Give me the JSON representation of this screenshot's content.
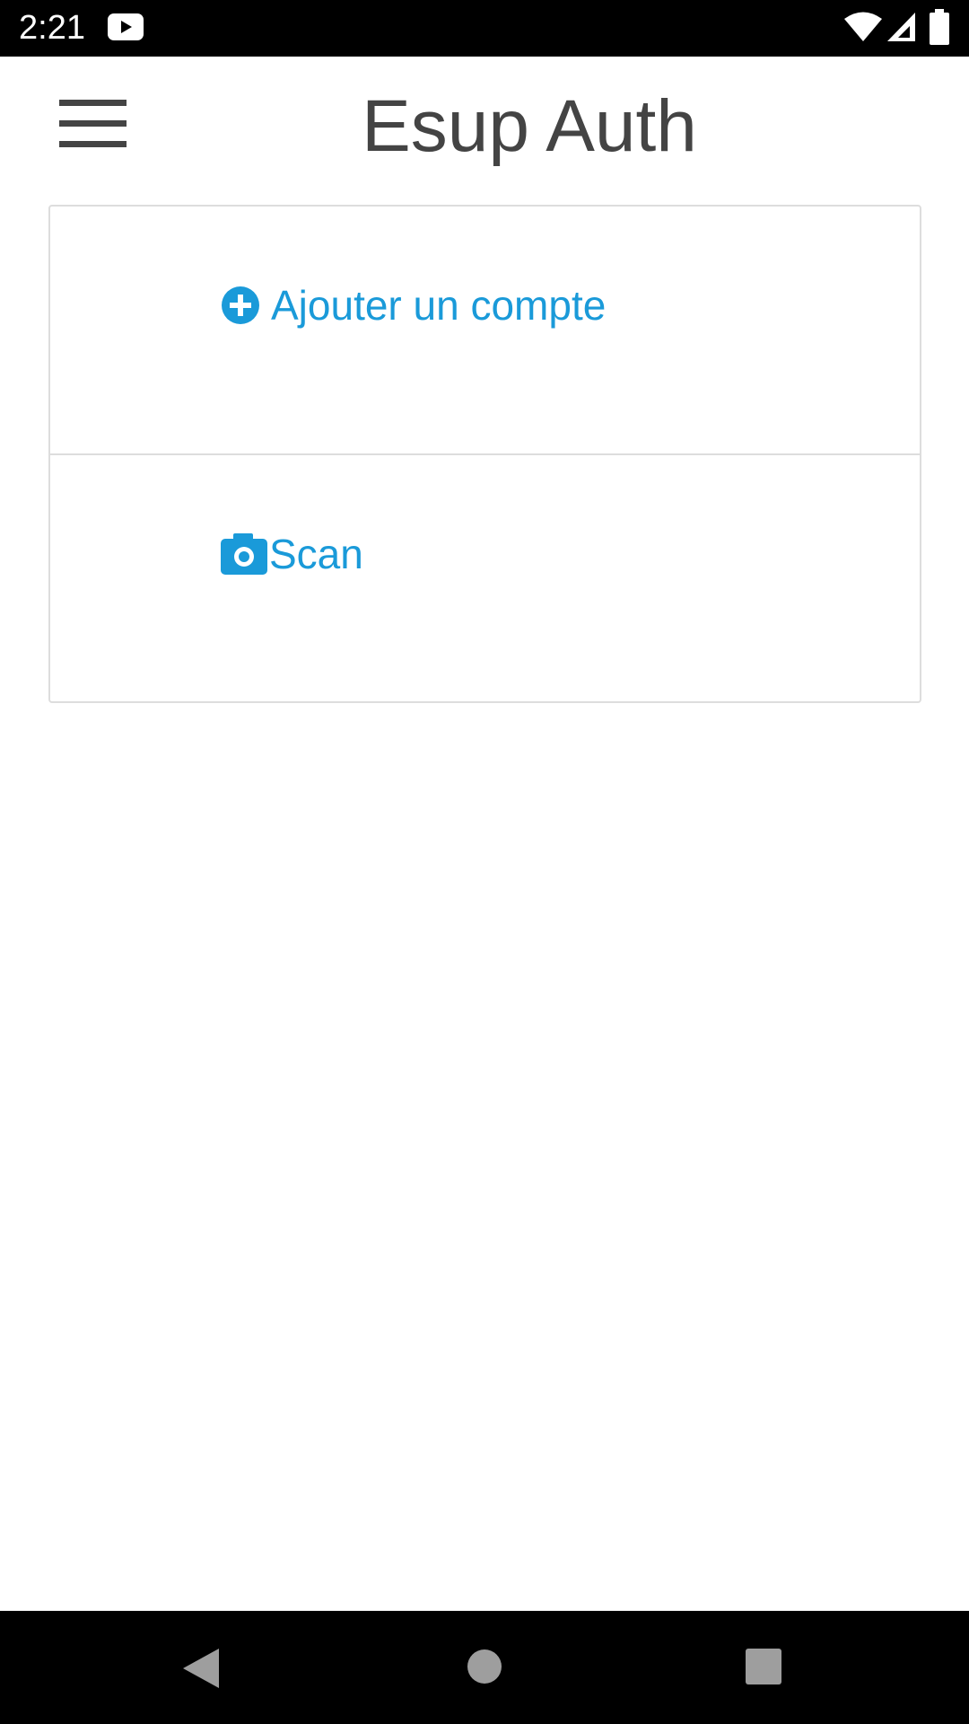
{
  "status_bar": {
    "time": "2:21",
    "icons": [
      "youtube-icon",
      "wifi-icon",
      "signal-icon",
      "battery-icon"
    ]
  },
  "header": {
    "title": "Esup Auth",
    "menu_icon": "hamburger-menu-icon"
  },
  "card": {
    "items": [
      {
        "label": "Ajouter un compte",
        "icon": "plus-circle-icon"
      },
      {
        "label": "Scan",
        "icon": "camera-icon"
      }
    ]
  },
  "nav_bar": {
    "icons": [
      "back-icon",
      "home-icon",
      "recents-icon"
    ]
  },
  "colors": {
    "accent": "#1a9ad9",
    "title_text": "#444444",
    "border": "#dddddd",
    "system_bar": "#000000",
    "nav_icon": "#9e9e9e"
  }
}
